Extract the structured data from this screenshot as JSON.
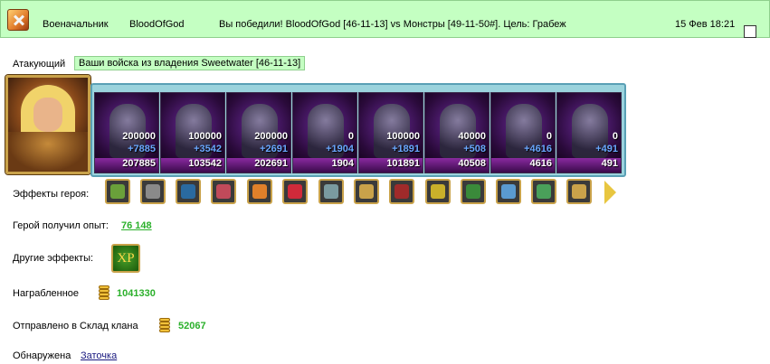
{
  "header": {
    "role": "Военачальник",
    "player": "BloodOfGod",
    "message": "Вы победили! BloodOfGod [46-11-13] vs Монстры [49-11-50#]. Цель: Грабеж",
    "datetime": "15 Фев 18:21",
    "icon": "crossed-swords-icon"
  },
  "attacker": {
    "label": "Атакующий",
    "name": "Ваши войска из владения Sweetwater [46-11-13]"
  },
  "troops": [
    {
      "count": "200000",
      "delta": "+7885",
      "total": "207885"
    },
    {
      "count": "100000",
      "delta": "+3542",
      "total": "103542"
    },
    {
      "count": "200000",
      "delta": "+2691",
      "total": "202691"
    },
    {
      "count": "0",
      "delta": "+1904",
      "total": "1904"
    },
    {
      "count": "100000",
      "delta": "+1891",
      "total": "101891"
    },
    {
      "count": "40000",
      "delta": "+508",
      "total": "40508"
    },
    {
      "count": "0",
      "delta": "+4616",
      "total": "4616"
    },
    {
      "count": "0",
      "delta": "+491",
      "total": "491"
    }
  ],
  "effects": {
    "label": "Эффекты героя:",
    "items": [
      {
        "icon": "grass-icon",
        "color": "#6aa03a"
      },
      {
        "icon": "helmet-icon",
        "color": "#8a8a8a"
      },
      {
        "icon": "orb-icon",
        "color": "#2a6aa0"
      },
      {
        "icon": "chest-icon",
        "color": "#c04a5a"
      },
      {
        "icon": "fire-icon",
        "color": "#e0802a"
      },
      {
        "icon": "heart-icon",
        "color": "#d02a3a"
      },
      {
        "icon": "shield-icon",
        "color": "#7a9aa0"
      },
      {
        "icon": "crown-icon",
        "color": "#c9a24a"
      },
      {
        "icon": "beetle-icon",
        "color": "#a02a2a"
      },
      {
        "icon": "armor-icon",
        "color": "#c9b02a"
      },
      {
        "icon": "mask-icon",
        "color": "#3a8a3a"
      },
      {
        "icon": "question-icon",
        "color": "#5a9ad0"
      },
      {
        "icon": "amulet-icon",
        "color": "#4aa05a"
      },
      {
        "icon": "gauntlet-icon",
        "color": "#c9a24a"
      }
    ]
  },
  "experience": {
    "label": "Герой получил опыт:",
    "value": "76 148"
  },
  "other_effects": {
    "label": "Другие эффекты:",
    "badge": "XP"
  },
  "loot": {
    "label": "Награбленное",
    "value": "1041330"
  },
  "clan": {
    "label": "Отправлено в Склад клана",
    "value": "52067"
  },
  "found": {
    "label": "Обнаружена",
    "link": "Заточка"
  }
}
